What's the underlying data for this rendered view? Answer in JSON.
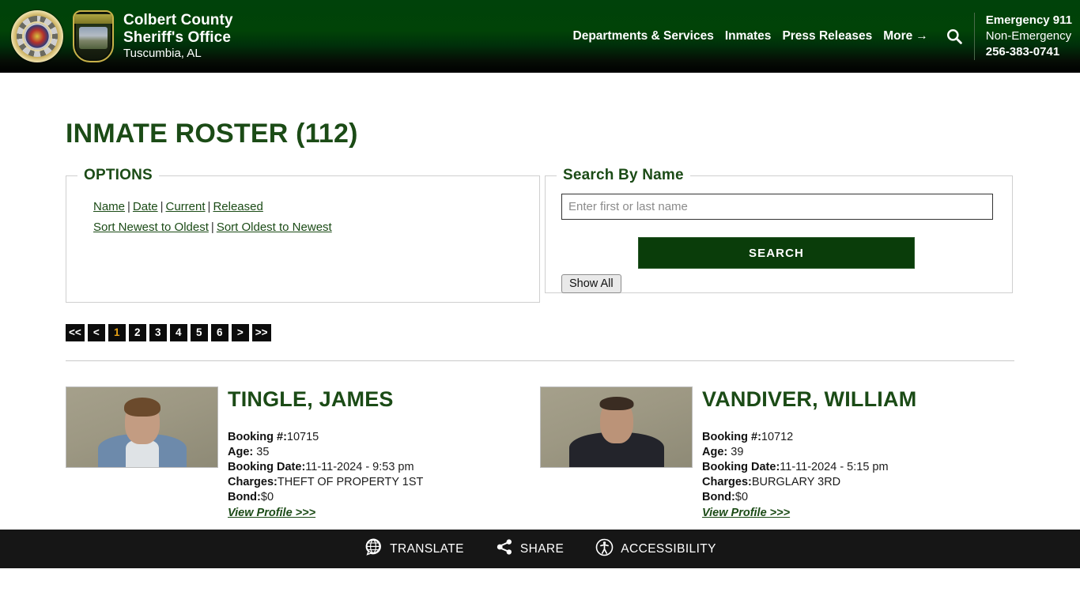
{
  "header": {
    "agency_line1": "Colbert County",
    "agency_line2": "Sheriff's Office",
    "agency_location": "Tuscumbia, AL",
    "logo_round_name": "colbert-county-sheriff-star-badge",
    "logo_shield_name": "sheriff-shield-patch",
    "nav": [
      {
        "label": "Departments & Services",
        "name": "nav-departments-services"
      },
      {
        "label": "Inmates",
        "name": "nav-inmates"
      },
      {
        "label": "Press Releases",
        "name": "nav-press-releases"
      }
    ],
    "more_label": "More",
    "more_arrow": "→",
    "search_icon": "search-icon",
    "emergency_label": "Emergency 911",
    "non_emergency_label": "Non-Emergency",
    "non_emergency_phone": "256-383-0741",
    "brand_green": "#00420a",
    "accent_green": "#1b4b16"
  },
  "main": {
    "page_title": "INMATE ROSTER (112)",
    "options": {
      "legend": "OPTIONS",
      "row1": [
        {
          "label": "Name",
          "name": "option-link-name"
        },
        {
          "label": "Date",
          "name": "option-link-date"
        },
        {
          "label": "Current",
          "name": "option-link-current"
        },
        {
          "label": "Released",
          "name": "option-link-released"
        }
      ],
      "row2": [
        {
          "label": "Sort Newest to Oldest",
          "name": "option-link-sort-newest-to-oldest"
        },
        {
          "label": "Sort Oldest to Newest",
          "name": "option-link-sort-oldest-to-newest"
        }
      ],
      "separator": "|"
    },
    "search": {
      "legend": "Search By Name",
      "placeholder": "Enter first or last name",
      "value": "",
      "search_button": "SEARCH",
      "show_all_button": "Show All"
    },
    "pagination": {
      "first": "<<",
      "prev": "<",
      "pages": [
        "1",
        "2",
        "3",
        "4",
        "5",
        "6"
      ],
      "active_page": "1",
      "next": ">",
      "last": ">>",
      "active_color": "#e8a317"
    },
    "labels": {
      "booking": "Booking #:",
      "age": "Age:",
      "booking_date": "Booking Date:",
      "charges": "Charges:",
      "bond": "Bond:",
      "view_profile": "View Profile >>>"
    },
    "inmates": [
      {
        "name": "TINGLE, JAMES",
        "booking_number": "10715",
        "age": "35",
        "booking_date": "11-11-2024 - 9:53 pm",
        "charges": "THEFT OF PROPERTY 1ST",
        "bond": "$0",
        "mugshot_name": "mugshot-tingle-james"
      },
      {
        "name": "VANDIVER, WILLIAM",
        "booking_number": "10712",
        "age": "39",
        "booking_date": "11-11-2024 - 5:15 pm",
        "charges": "BURGLARY 3RD",
        "bond": "$0",
        "mugshot_name": "mugshot-vandiver-william"
      }
    ]
  },
  "footer": {
    "translate_label": "TRANSLATE",
    "share_label": "SHARE",
    "accessibility_label": "ACCESSIBILITY",
    "background": "#161616"
  }
}
